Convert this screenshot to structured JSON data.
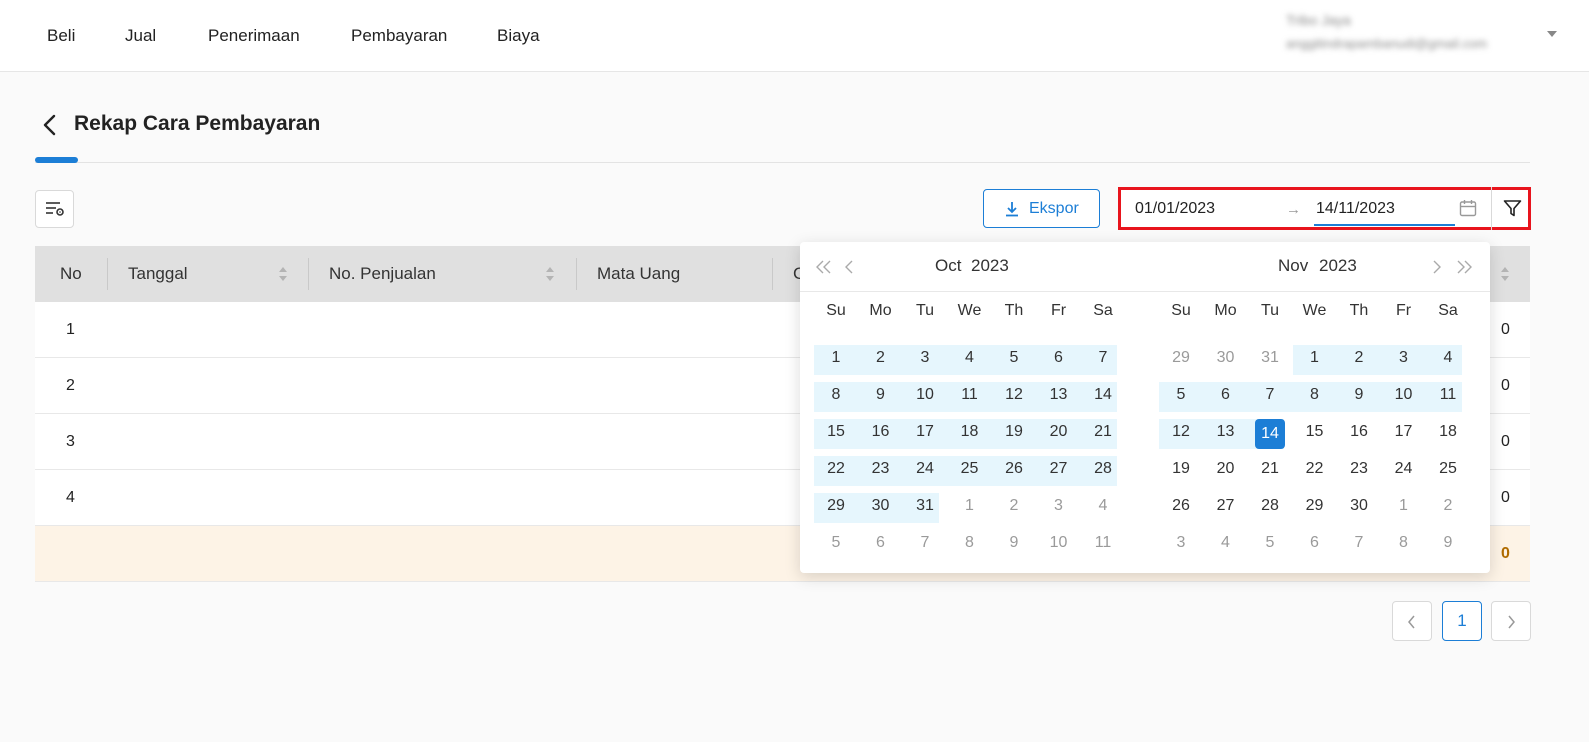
{
  "nav": {
    "items": [
      "Beli",
      "Jual",
      "Penerimaan",
      "Pembayaran",
      "Biaya"
    ]
  },
  "user": {
    "name": "Tribo Jaya",
    "email": "anggitindrapambanudi@gmail.com"
  },
  "page": {
    "title": "Rekap Cara Pembayaran"
  },
  "toolbar": {
    "export_label": "Ekspor",
    "range_start": "01/01/2023",
    "range_separator": "→",
    "range_end": "14/11/2023"
  },
  "table": {
    "headers": [
      "No",
      "Tanggal",
      "No. Penjualan",
      "Mata Uang",
      "C"
    ],
    "rows": [
      {
        "no": "1",
        "tail": "0"
      },
      {
        "no": "2",
        "tail": "0"
      },
      {
        "no": "3",
        "tail": "0"
      },
      {
        "no": "4",
        "tail": "0"
      }
    ],
    "total_tail": "0"
  },
  "pagination": {
    "current": "1"
  },
  "calendar": {
    "left": {
      "month": "Oct",
      "year": "2023",
      "weekdays": [
        "Su",
        "Mo",
        "Tu",
        "We",
        "Th",
        "Fr",
        "Sa"
      ],
      "weeks": [
        [
          "1",
          "2",
          "3",
          "4",
          "5",
          "6",
          "7"
        ],
        [
          "8",
          "9",
          "10",
          "11",
          "12",
          "13",
          "14"
        ],
        [
          "15",
          "16",
          "17",
          "18",
          "19",
          "20",
          "21"
        ],
        [
          "22",
          "23",
          "24",
          "25",
          "26",
          "27",
          "28"
        ],
        [
          "29",
          "30",
          "31",
          "1",
          "2",
          "3",
          "4"
        ],
        [
          "5",
          "6",
          "7",
          "8",
          "9",
          "10",
          "11"
        ]
      ]
    },
    "right": {
      "month": "Nov",
      "year": "2023",
      "weekdays": [
        "Su",
        "Mo",
        "Tu",
        "We",
        "Th",
        "Fr",
        "Sa"
      ],
      "weeks": [
        [
          "29",
          "30",
          "31",
          "1",
          "2",
          "3",
          "4"
        ],
        [
          "5",
          "6",
          "7",
          "8",
          "9",
          "10",
          "11"
        ],
        [
          "12",
          "13",
          "14",
          "15",
          "16",
          "17",
          "18"
        ],
        [
          "19",
          "20",
          "21",
          "22",
          "23",
          "24",
          "25"
        ],
        [
          "26",
          "27",
          "28",
          "29",
          "30",
          "1",
          "2"
        ],
        [
          "3",
          "4",
          "5",
          "6",
          "7",
          "8",
          "9"
        ]
      ],
      "selected": "14"
    }
  },
  "colors": {
    "accent": "#1c7ed6",
    "highlight_border": "#e8141d",
    "range_band": "#e6f6fd",
    "total_row": "#fdf3e6"
  }
}
